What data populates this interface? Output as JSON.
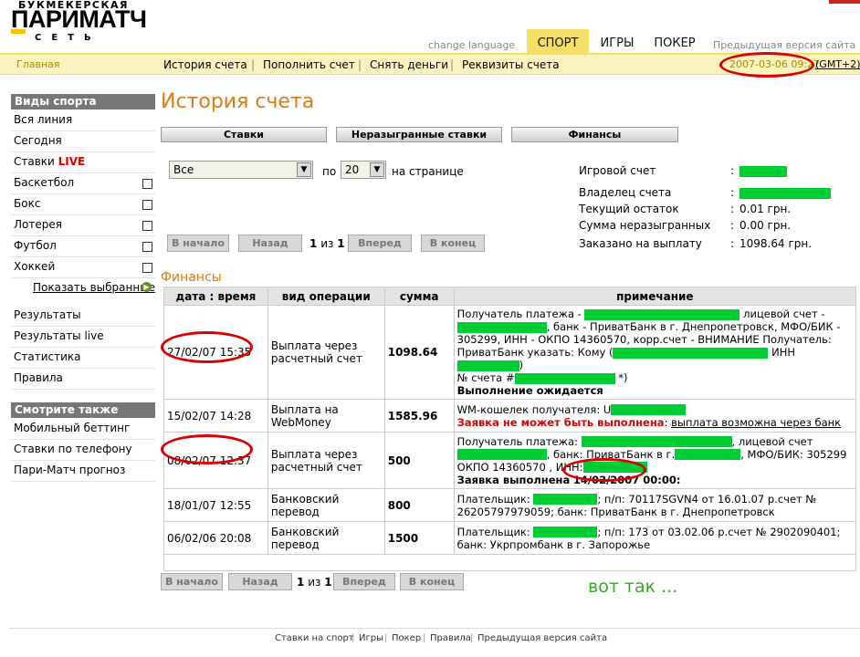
{
  "logo": {
    "top": "БУКМЕКЕРСКАЯ",
    "main": "ПАРИМАТЧ",
    "bottom": "СЕТЬ"
  },
  "header": {
    "change_language": "change language",
    "tabs": [
      {
        "label": "СПОРТ",
        "active": true
      },
      {
        "label": "ИГРЫ",
        "active": false
      },
      {
        "label": "ПОКЕР",
        "active": false
      }
    ],
    "prev_site": "Предыдущая версия сайта"
  },
  "nav": {
    "home": "Главная",
    "links": [
      "История счета",
      "Пополнить счет",
      "Снять деньги",
      "Реквизиты счета"
    ],
    "clock": "2007-03-06 09:27",
    "gmt": "GMT+2"
  },
  "sidebar": {
    "sports_header": "Виды спорта",
    "items": [
      {
        "label": "Вся линия",
        "checkbox": false
      },
      {
        "label": "Сегодня",
        "checkbox": false
      },
      {
        "label": "Ставки ",
        "live": "LIVE",
        "checkbox": false
      },
      {
        "label": "Баскетбол",
        "checkbox": true
      },
      {
        "label": "Бокс",
        "checkbox": true
      },
      {
        "label": "Лотерея",
        "checkbox": true
      },
      {
        "label": "Футбол",
        "checkbox": true
      },
      {
        "label": "Хоккей",
        "checkbox": true
      }
    ],
    "show_selected": "Показать выбранные",
    "links": [
      "Результаты",
      "Результаты live",
      "Статистика",
      "Правила"
    ],
    "see_also_header": "Смотрите также",
    "see_also": [
      "Мобильный беттинг",
      "Ставки по телефону",
      "Пари-Матч прогноз"
    ]
  },
  "main": {
    "title": "История счета",
    "filter_tabs": [
      "Ставки",
      "Неразыгранные ставки",
      "Финансы"
    ],
    "filter": {
      "type_value": "Все",
      "per_label": "по",
      "per_value": "20",
      "per_suffix": "на странице"
    },
    "pager": {
      "first": "В начало",
      "back": "Назад",
      "current": "1",
      "of": "из",
      "total": "1",
      "next": "Вперед",
      "last": "В конец"
    },
    "account": [
      {
        "label": "Игровой счет",
        "value": ""
      },
      {
        "label": "Владелец счета",
        "value": ""
      },
      {
        "label": "Текущий остаток",
        "value": "0.01 грн."
      },
      {
        "label": "Сумма неразыгранных",
        "value": "0.00 грн."
      },
      {
        "label": "Заказано на выплату",
        "value": "1098.64 грн."
      }
    ],
    "section_title": "Финансы",
    "table": {
      "headers": [
        "дата : время",
        "вид операции",
        "сумма",
        "примечание"
      ],
      "rows": [
        {
          "date": "27/02/07 15:35",
          "op": "Выплата через расчетный счет",
          "sum": "1098.64",
          "note_lines": [
            "Получатель платежа -",
            "лицевой счет -",
            ", банк - ПриватБанк в г. Днепропетровск, МФО/БИК -",
            "305299, ИНН - ОКПО 14360570, корр.счет - ВНИМАНИЕ Получатель:",
            "ПриватБанк указать: Кому (",
            "ИНН",
            "№ счета #",
            "*)"
          ],
          "status": "Выполнение ожидается"
        },
        {
          "date": "15/02/07 14:28",
          "op": "Выплата на WebMoney",
          "sum": "1585.96",
          "note_lines": [
            "WM-кошелек получателя: U"
          ],
          "status_red": "Заявка не может быть выполнена",
          "status_link": "выплата возможна через банк"
        },
        {
          "date": "08/02/07 12:37",
          "op": "Выплата через расчетный счет",
          "sum": "500",
          "note_lines": [
            "Получатель платежа:",
            ", лицевой счет",
            ", банк: ПриватБанк в г.",
            ", МФО/БИК: 305299",
            "ОКПО 14360570 , ИНН:"
          ],
          "status": "Заявка выполнена",
          "status_date": "14/02/2007 00:00:"
        },
        {
          "date": "18/01/07 12:55",
          "op": "Банковский перевод",
          "sum": "800",
          "note_lines": [
            "Плательщик:",
            "; п/п: 70117SGVN4 от 16.01.07 р.счет №",
            "26205797979059; банк: ПриватБанк в г. Днепропетровск"
          ]
        },
        {
          "date": "06/02/06 20:08",
          "op": "Банковский перевод",
          "sum": "1500",
          "note_lines": [
            "Плательщик:",
            "; п/п: 173 от 03.02.06 р.счет № 2902090401;",
            "банк: Укрпромбанк в г. Запорожье"
          ]
        }
      ]
    },
    "annotation": "вот так ..."
  },
  "footer": [
    "Ставки на спорт",
    "Игры",
    "Покер",
    "Правила",
    "Предыдущая версия сайта"
  ],
  "colors": {
    "accent": "#e07a10",
    "tab_yellow": "#f5df66",
    "nav_bg": "#faf3c0",
    "redact": "#00cc33",
    "ring": "#d80000"
  }
}
